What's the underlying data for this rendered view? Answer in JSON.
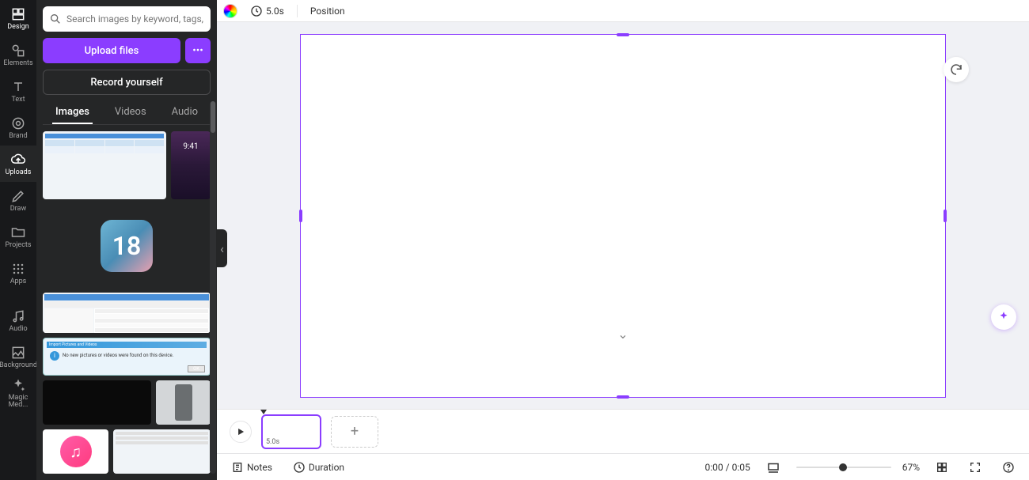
{
  "rail": {
    "items": [
      {
        "label": "Design"
      },
      {
        "label": "Elements"
      },
      {
        "label": "Text"
      },
      {
        "label": "Brand"
      },
      {
        "label": "Uploads"
      },
      {
        "label": "Draw"
      },
      {
        "label": "Projects"
      },
      {
        "label": "Apps"
      },
      {
        "label": "Audio"
      },
      {
        "label": "Background"
      },
      {
        "label": "Magic Med..."
      }
    ],
    "active_index": 4
  },
  "panel": {
    "search_placeholder": "Search images by keyword, tags, color...",
    "upload_label": "Upload files",
    "record_label": "Record yourself",
    "tabs": [
      "Images",
      "Videos",
      "Audio"
    ],
    "active_tab": 0,
    "thumbs": {
      "phone_time": "9:41",
      "ios18": "18",
      "import_title": "Import Pictures and Videos",
      "import_body": "No new pictures or videos were found on this device.",
      "import_ok": "OK"
    }
  },
  "topbar": {
    "duration": "5.0s",
    "position_label": "Position"
  },
  "timeline": {
    "clip_duration": "5.0s"
  },
  "bottombar": {
    "notes_label": "Notes",
    "duration_label": "Duration",
    "time_display": "0:00 / 0:05",
    "zoom_label": "67%"
  },
  "colors": {
    "accent": "#8b3dff",
    "panel_bg": "#252627",
    "rail_bg": "#18191b"
  }
}
